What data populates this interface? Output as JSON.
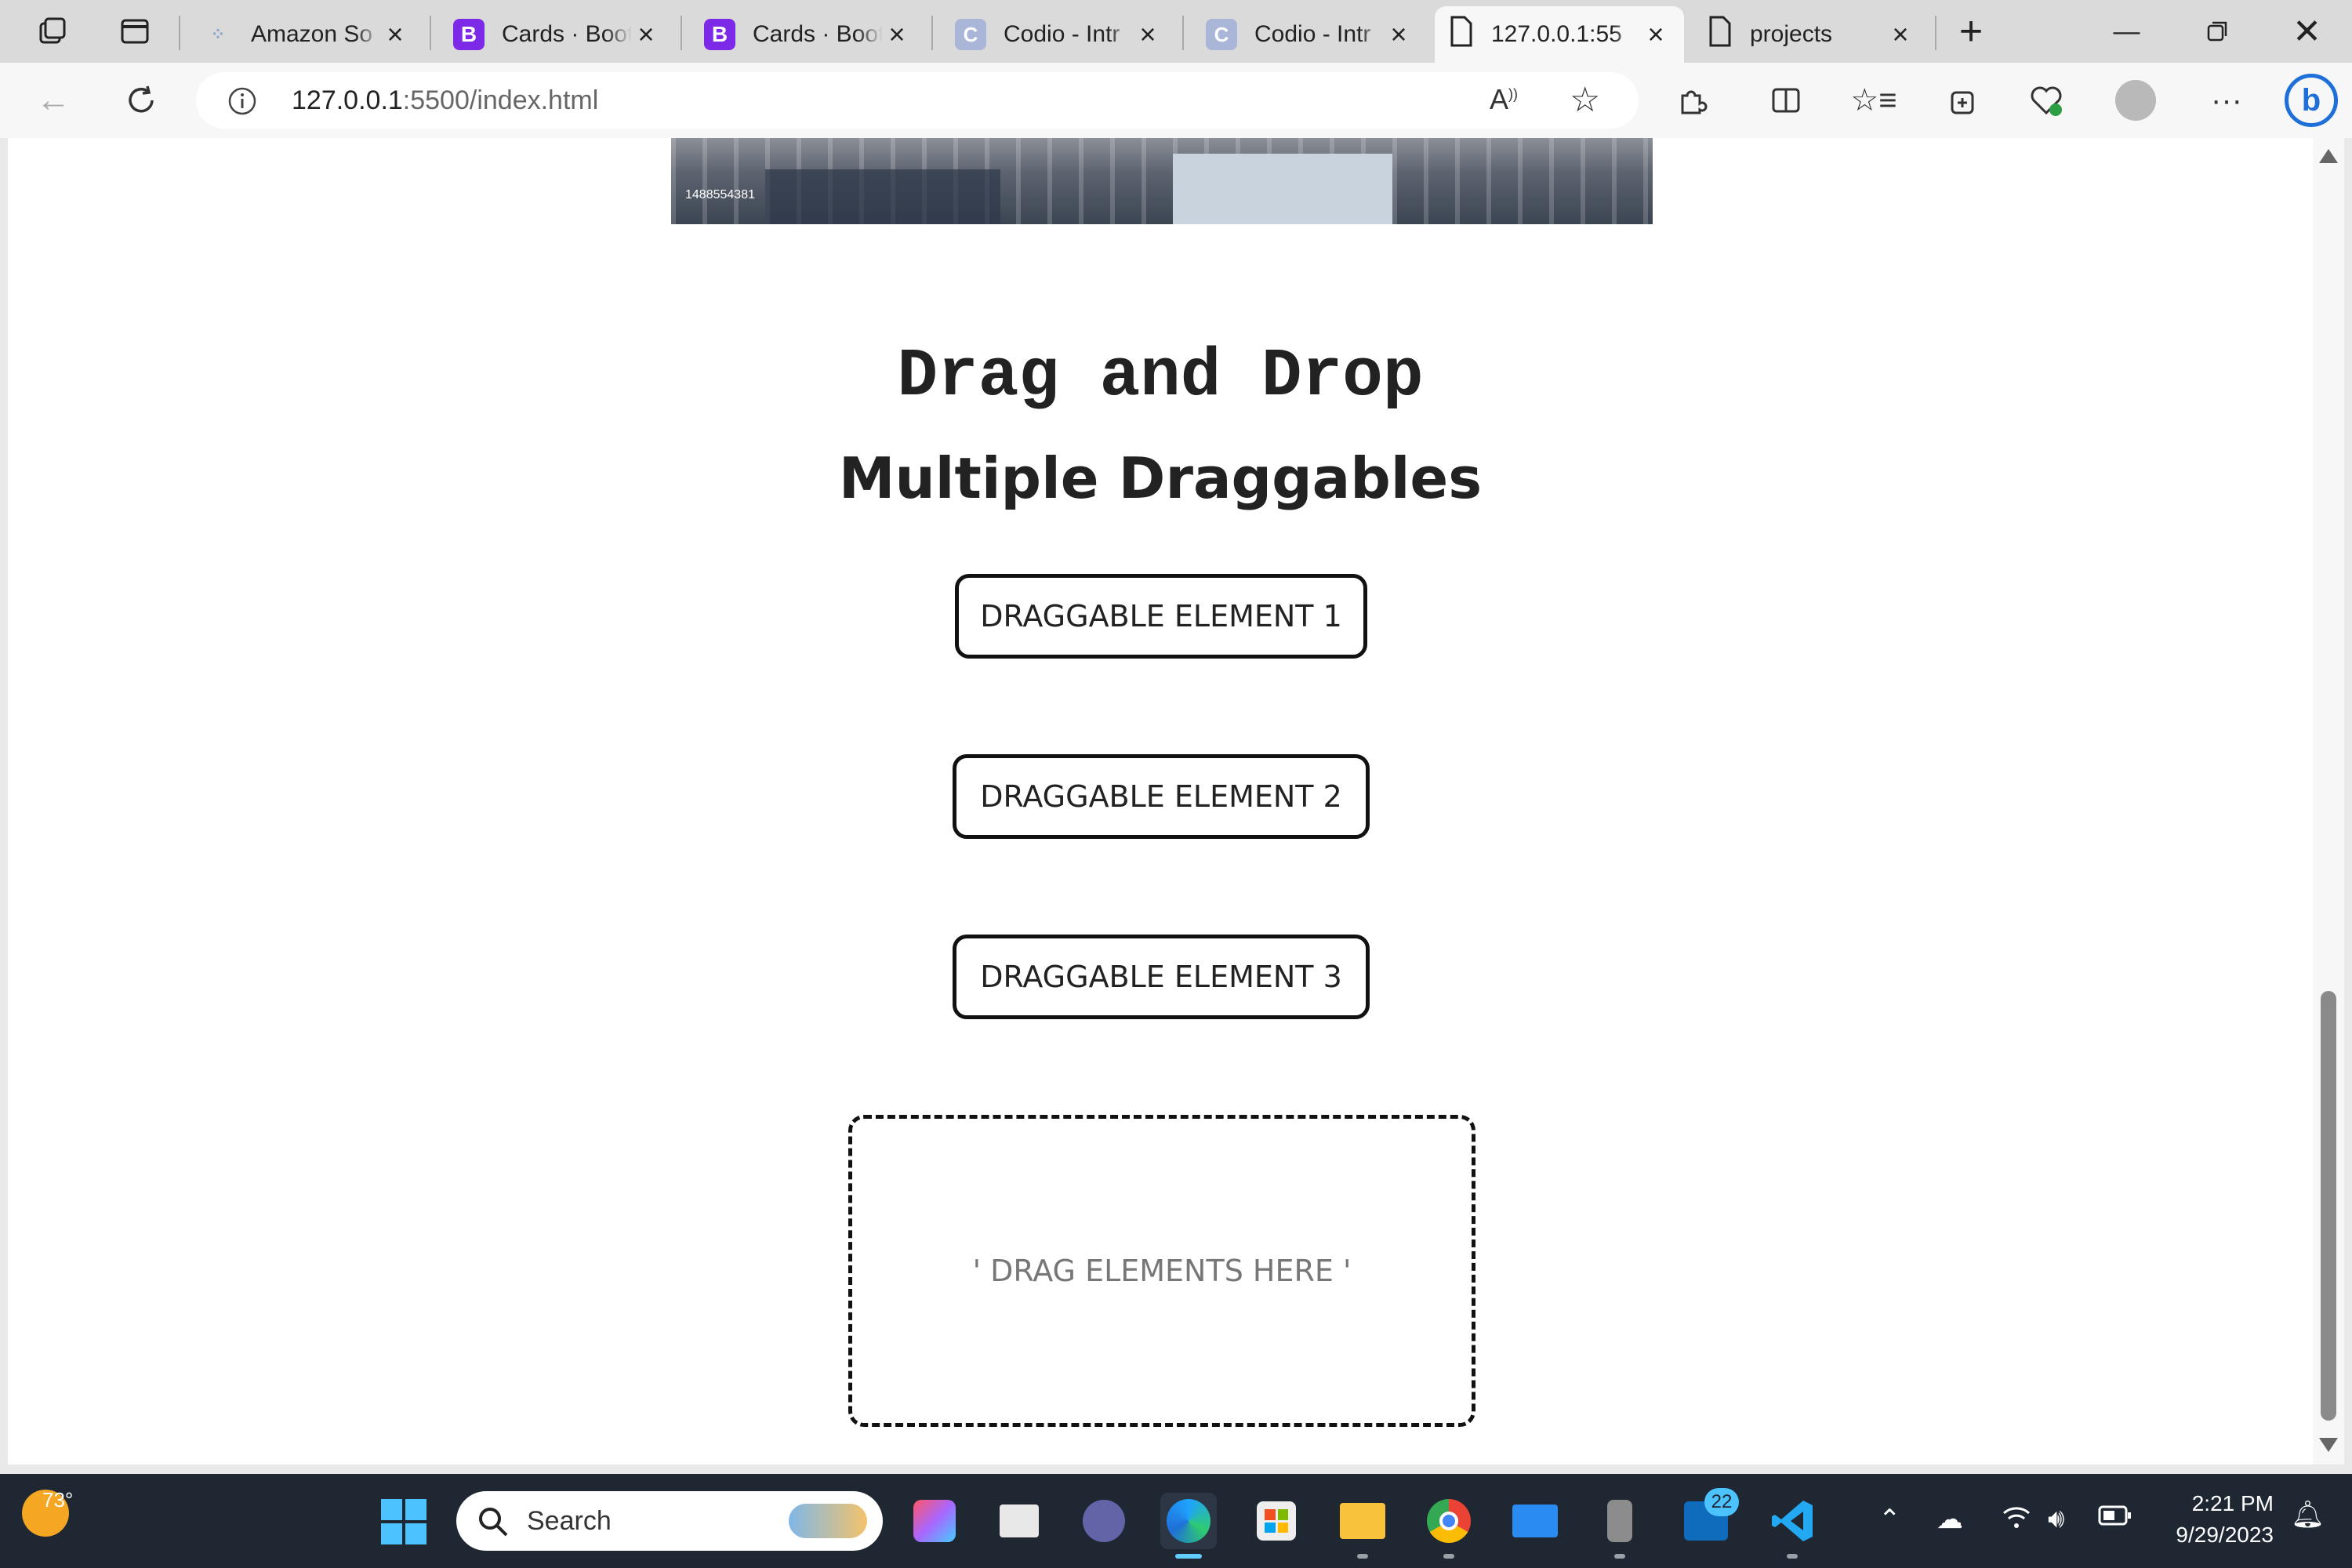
{
  "browser": {
    "tabs": [
      {
        "title": "Amazon So",
        "favicon": "dots",
        "active": false
      },
      {
        "title": "Cards · Boot",
        "favicon": "B",
        "active": false
      },
      {
        "title": "Cards · Boot",
        "favicon": "B",
        "active": false
      },
      {
        "title": "Codio - Intr",
        "favicon": "C",
        "active": false
      },
      {
        "title": "Codio - Intr",
        "favicon": "C",
        "active": false
      },
      {
        "title": "127.0.0.1:55",
        "favicon": "page",
        "active": true
      },
      {
        "title": "projects",
        "favicon": "page",
        "active": false
      }
    ],
    "url_host": "127.0.0.1",
    "url_path": ":5500/index.html"
  },
  "page": {
    "hero_caption": "1488554381",
    "title": "Drag and Drop",
    "subtitle": "Multiple Draggables",
    "draggables": [
      {
        "label": "DRAGGABLE ELEMENT 1"
      },
      {
        "label": "DRAGGABLE ELEMENT 2"
      },
      {
        "label": "DRAGGABLE ELEMENT 3"
      }
    ],
    "dropzone_label": "' DRAG ELEMENTS HERE '"
  },
  "taskbar": {
    "weather_temp": "73°",
    "search_label": "Search",
    "mail_badge": "22",
    "time": "2:21 PM",
    "date": "9/29/2023"
  },
  "colors": {
    "accent_blue": "#4cc2ff",
    "bootstrap_purple": "#7d2ae8",
    "taskbar_bg": "#1f2733"
  }
}
